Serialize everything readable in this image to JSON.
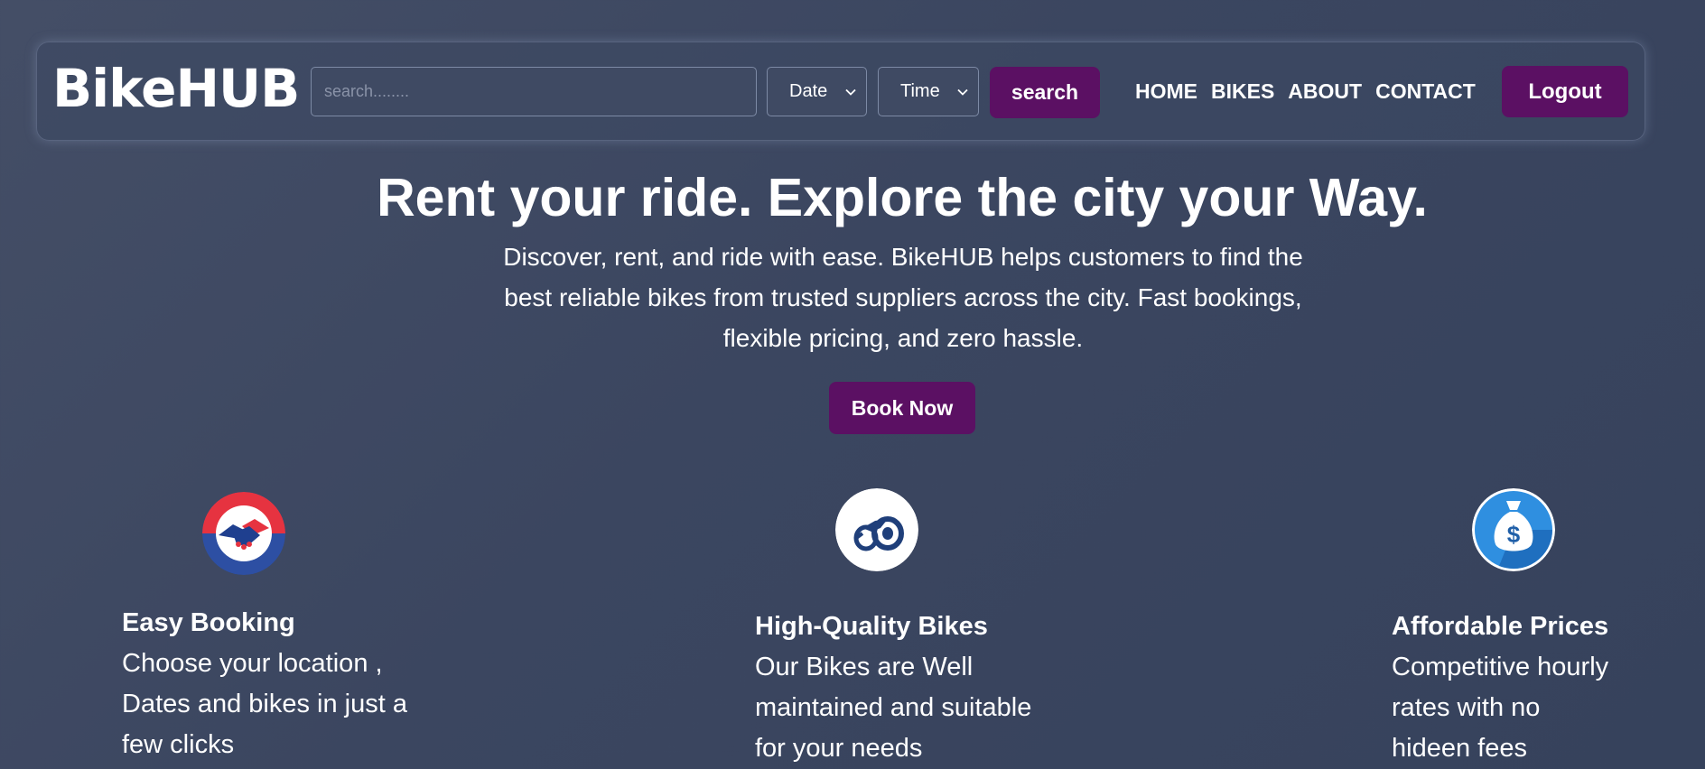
{
  "brand": {
    "logo": "BikeHUB"
  },
  "search": {
    "placeholder": "search........",
    "date_label": "Date",
    "time_label": "Time",
    "button": "search"
  },
  "nav": {
    "links": [
      "HOME",
      "BIKES",
      "ABOUT",
      "CONTACT"
    ],
    "logout": "Logout"
  },
  "hero": {
    "title": "Rent your ride. Explore the city your Way.",
    "lines": [
      "Discover, rent, and ride with ease. BikeHUB helps customers to find the",
      "best reliable bikes from trusted suppliers across the city. Fast bookings,",
      "flexible pricing, and zero hassle."
    ],
    "cta": "Book Now"
  },
  "features": [
    {
      "icon": "handshake-icon",
      "title": "Easy Booking",
      "lines": [
        "Choose your location ,",
        "Dates and bikes in just a",
        "few clicks"
      ]
    },
    {
      "icon": "motorbike-icon",
      "title": "High-Quality Bikes",
      "lines": [
        "Our Bikes are Well",
        "maintained and suitable",
        "for your needs"
      ]
    },
    {
      "icon": "money-bag-icon",
      "title": "Affordable Prices",
      "lines": [
        "Competitive hourly",
        "rates with no",
        "hideen fees"
      ]
    }
  ],
  "colors": {
    "accent": "#5b1063",
    "background": "#3b4660"
  }
}
